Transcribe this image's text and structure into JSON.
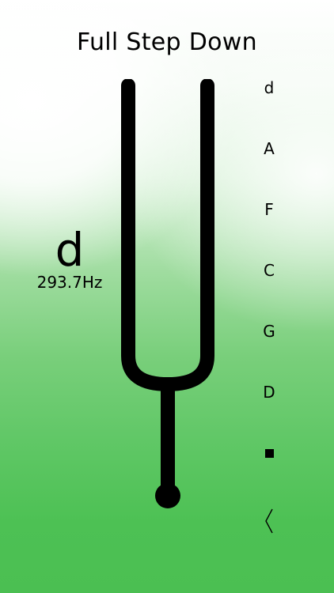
{
  "header": {
    "title": "Full Step Down"
  },
  "current_note": {
    "name": "d",
    "frequency": "293.7Hz"
  },
  "strings": [
    {
      "label": "d"
    },
    {
      "label": "A"
    },
    {
      "label": "F"
    },
    {
      "label": "C"
    },
    {
      "label": "G"
    },
    {
      "label": "D"
    }
  ],
  "controls": {
    "stop_icon": "stop-square-icon",
    "back_icon": "chevron-left-icon"
  },
  "colors": {
    "background_top": "#ffffff",
    "background_bottom": "#4bbf52",
    "fork": "#000000"
  }
}
